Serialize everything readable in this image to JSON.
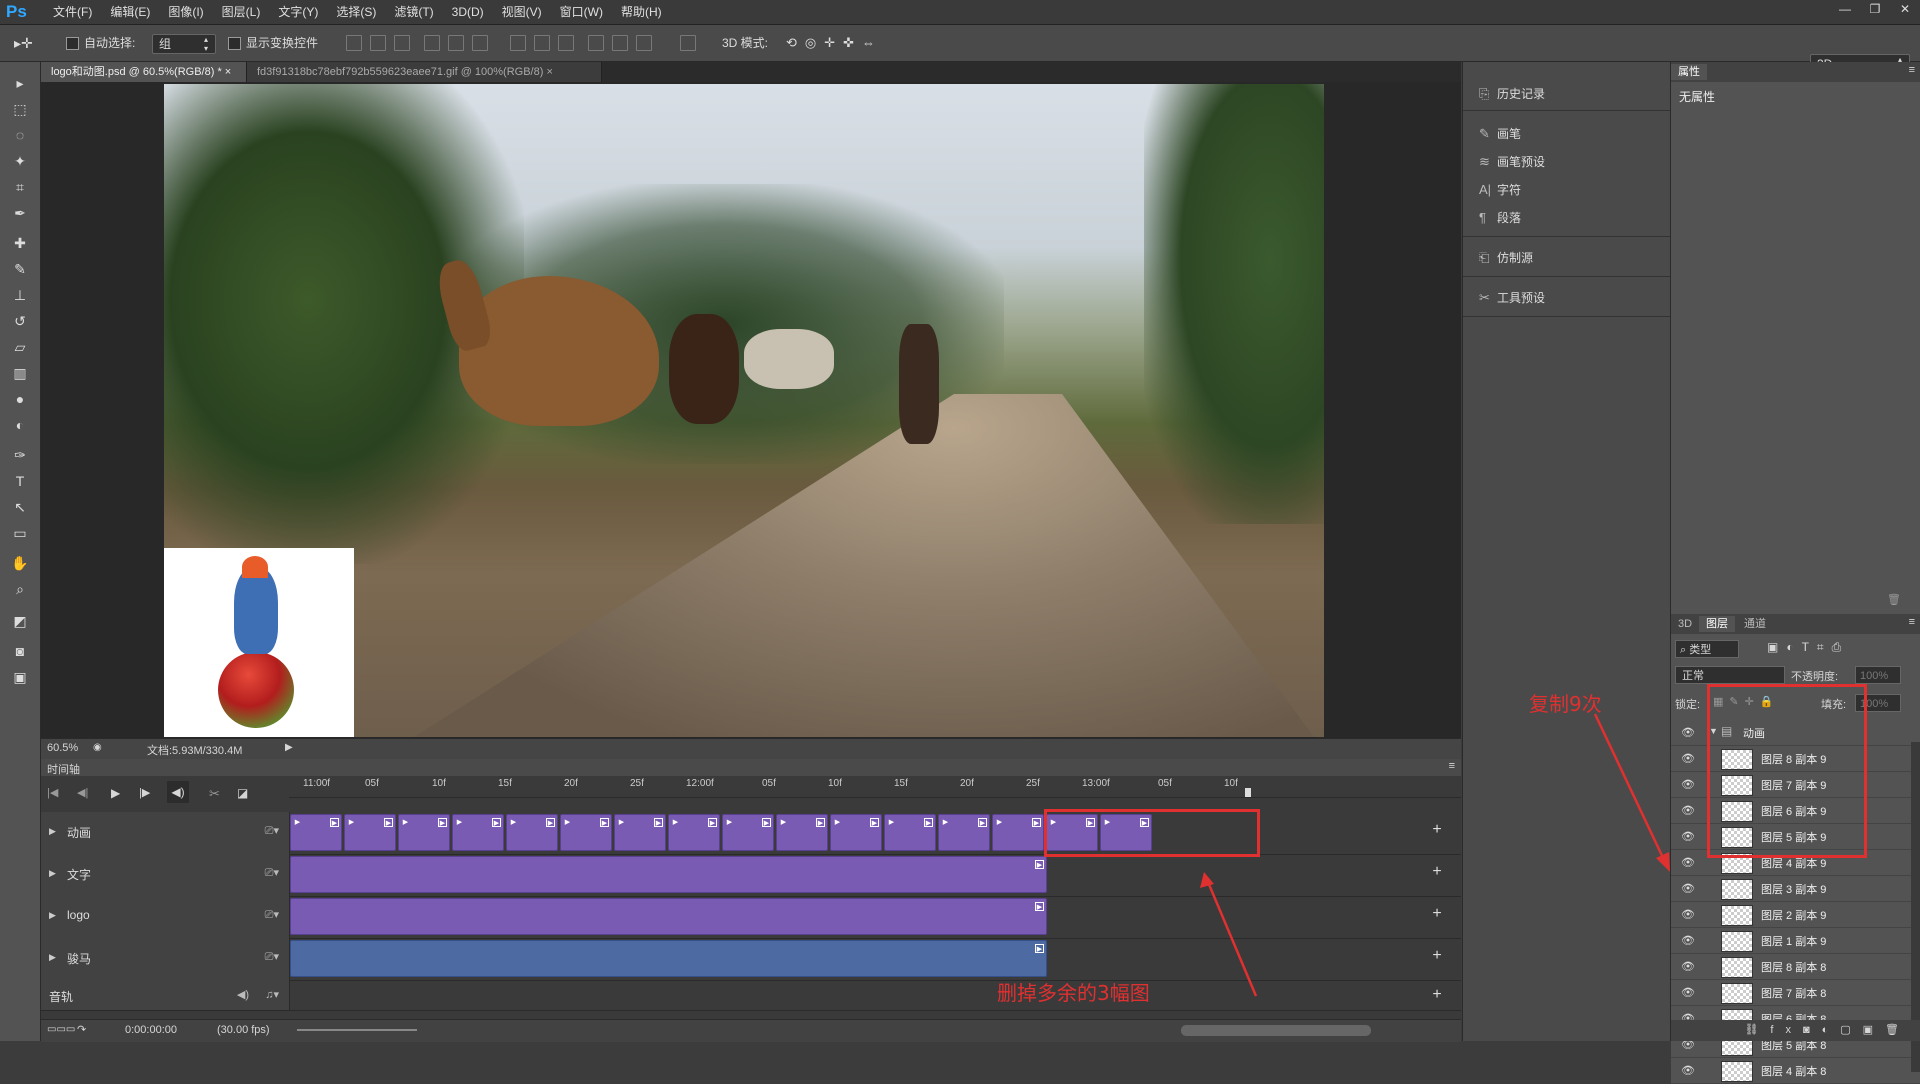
{
  "app": {
    "logo": "Ps"
  },
  "menu": [
    "文件(F)",
    "编辑(E)",
    "图像(I)",
    "图层(L)",
    "文字(Y)",
    "选择(S)",
    "滤镜(T)",
    "3D(D)",
    "视图(V)",
    "窗口(W)",
    "帮助(H)"
  ],
  "window_controls": [
    "—",
    "❐",
    "✕"
  ],
  "options": {
    "auto_select_label": "自动选择:",
    "auto_select_value": "组",
    "show_transform_label": "显示变换控件",
    "mode_3d_label": "3D 模式:",
    "workspace_value": "3D"
  },
  "tabs": [
    {
      "label": "logo和动图.psd @ 60.5%(RGB/8) *",
      "close": "×"
    },
    {
      "label": "fd3f91318bc78ebf792b559623eaee71.gif @ 100%(RGB/8)",
      "close": "×"
    }
  ],
  "status": {
    "zoom": "60.5%",
    "doc": "文档:5.93M/330.4M"
  },
  "timeline": {
    "title": "时间轴",
    "ruler_ticks": [
      "11:00f",
      "05f",
      "10f",
      "15f",
      "20f",
      "25f",
      "12:00f",
      "05f",
      "10f",
      "15f",
      "20f",
      "25f",
      "13:00f",
      "05f",
      "10f"
    ],
    "tracks": [
      {
        "name": "动画"
      },
      {
        "name": "文字"
      },
      {
        "name": "logo"
      },
      {
        "name": "骏马"
      }
    ],
    "audio_label": "音轨",
    "timecode": "0:00:00:00",
    "fps": "(30.00 fps)",
    "add": "+"
  },
  "annotations": {
    "copy": "复制9次",
    "delete": "删掉多余的3幅图"
  },
  "mid_panel": [
    {
      "icon": "history-icon",
      "glyph": "⎘",
      "label": "历史记录"
    },
    {
      "icon": "brush-icon",
      "glyph": "✎",
      "label": "画笔"
    },
    {
      "icon": "brush-presets-icon",
      "glyph": "≋",
      "label": "画笔预设"
    },
    {
      "icon": "character-icon",
      "glyph": "A|",
      "label": "字符"
    },
    {
      "icon": "paragraph-icon",
      "glyph": "¶",
      "label": "段落"
    },
    {
      "icon": "clone-source-icon",
      "glyph": "⎗",
      "label": "仿制源"
    },
    {
      "icon": "tool-presets-icon",
      "glyph": "✂",
      "label": "工具预设"
    }
  ],
  "properties": {
    "tab": "属性",
    "body": "无属性"
  },
  "layers_panel": {
    "tabs": [
      "3D",
      "图层",
      "通道"
    ],
    "filter_value": "类型",
    "blend_value": "正常",
    "opacity_label": "不透明度:",
    "opacity_value": "100%",
    "lock_label": "锁定:",
    "fill_label": "填充:",
    "fill_value": "100%",
    "group": "动画",
    "layers": [
      "图层 8 副本 9",
      "图层 7 副本 9",
      "图层 6 副本 9",
      "图层 5 副本 9",
      "图层 4 副本 9",
      "图层 3 副本 9",
      "图层 2 副本 9",
      "图层 1 副本 9",
      "图层 8 副本 8",
      "图层 7 副本 8",
      "图层 6 副本 8",
      "图层 5 副本 8",
      "图层 4 副本 8"
    ]
  }
}
